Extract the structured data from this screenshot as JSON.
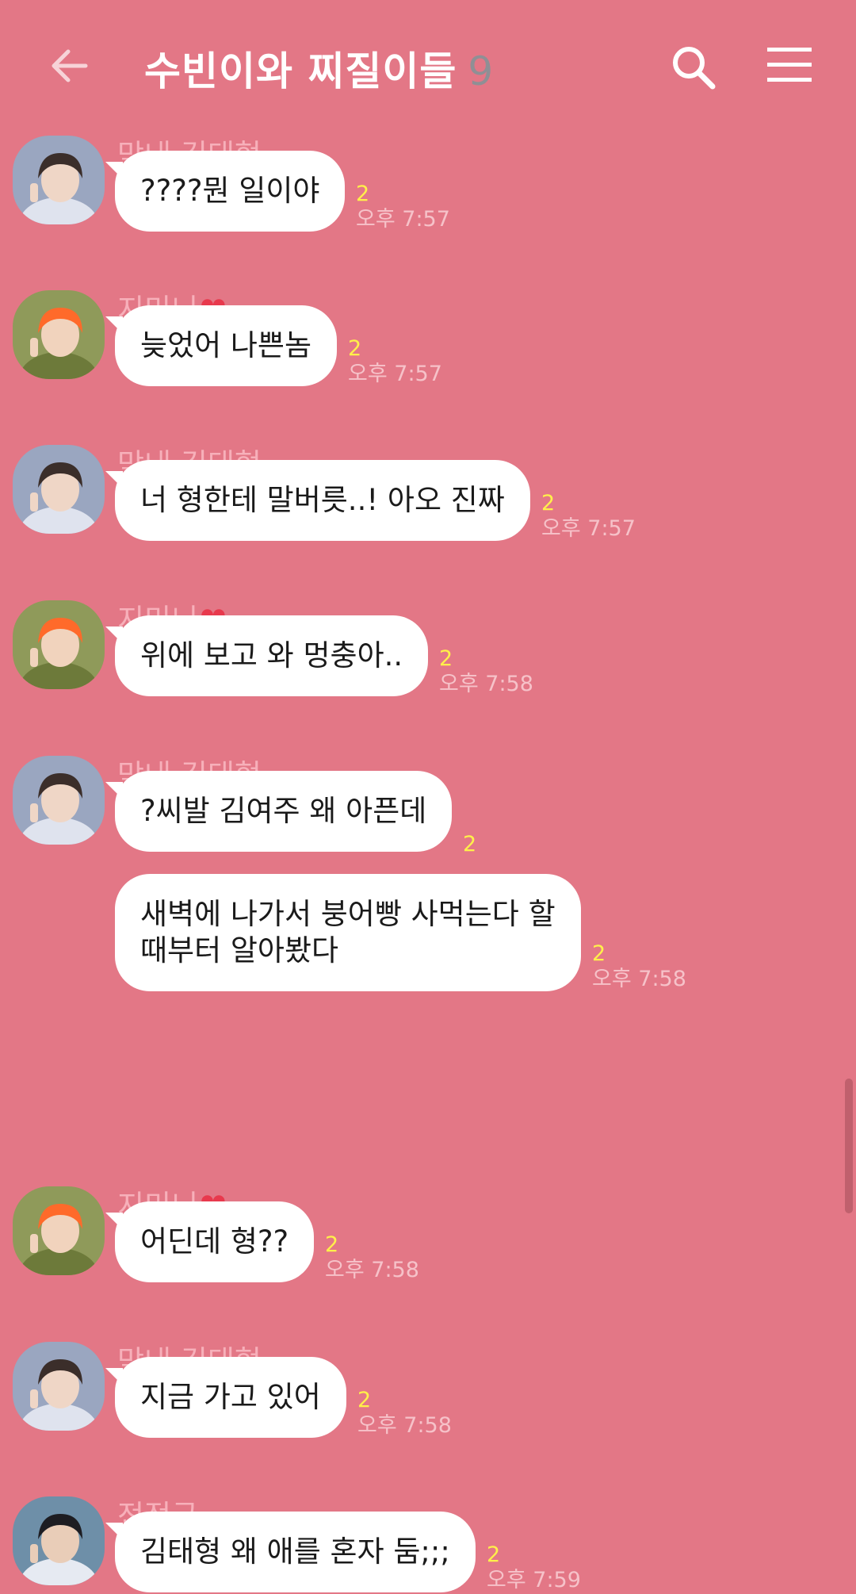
{
  "header": {
    "title": "수빈이와 찌질이들",
    "member_count": "9",
    "back_icon": "arrow-left-icon",
    "search_icon": "search-icon",
    "menu_icon": "hamburger-menu-icon"
  },
  "colors": {
    "background": "#e37786",
    "sender_name": "#f7b0ba",
    "unread": "#fff04a",
    "bubble": "#ffffff"
  },
  "messages": [
    {
      "sender": "막내 김태형",
      "bubbles": [
        {
          "text": "????뭔 일이야",
          "unread": "2",
          "time": "오후 7:57"
        }
      ]
    },
    {
      "sender": "지미니",
      "bubbles": [
        {
          "text": "늦었어 나쁜놈",
          "unread": "2",
          "time": "오후 7:57"
        }
      ]
    },
    {
      "sender": "막내 김태형",
      "bubbles": [
        {
          "text": "너 형한테 말버릇..! 아오 진짜",
          "unread": "2",
          "time": "오후 7:57"
        }
      ]
    },
    {
      "sender": "지미니",
      "bubbles": [
        {
          "text": "위에 보고 와 멍충아..",
          "unread": "2",
          "time": "오후 7:58"
        }
      ]
    },
    {
      "sender": "막내 김태형",
      "bubbles": [
        {
          "text": "?씨발 김여주 왜 아픈데",
          "unread": "2",
          "time": ""
        },
        {
          "text": "새벽에 나가서 붕어빵 사먹는다 할\n때부터 알아봤다",
          "unread": "2",
          "time": "오후 7:58"
        }
      ]
    },
    {
      "sender": "지미니",
      "bubbles": [
        {
          "text": "어딘데 형??",
          "unread": "2",
          "time": "오후 7:58"
        }
      ]
    },
    {
      "sender": "막내 김태형",
      "bubbles": [
        {
          "text": "지금 가고 있어",
          "unread": "2",
          "time": "오후 7:58"
        }
      ]
    },
    {
      "sender": "전정국",
      "bubbles": [
        {
          "text": "김태형 왜 애를 혼자 둠;;;",
          "unread": "2",
          "time": "오후 7:59"
        }
      ]
    }
  ]
}
